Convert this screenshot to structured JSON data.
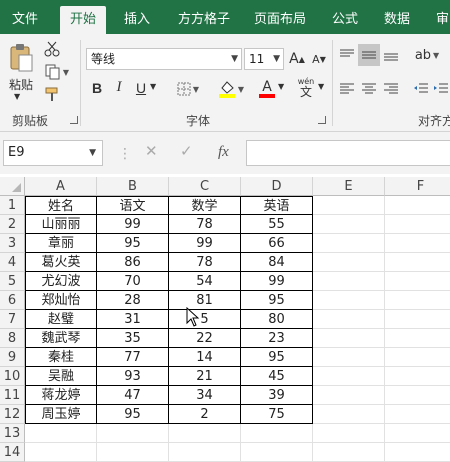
{
  "ribbon_tabs": [
    "文件",
    "开始",
    "插入",
    "方方格子",
    "页面布局",
    "公式",
    "数据",
    "审"
  ],
  "active_tab": "开始",
  "clipboard": {
    "paste_label": "粘贴",
    "group_label": "剪贴板"
  },
  "font": {
    "name": "等线",
    "size": "11",
    "group_label": "字体",
    "grow_label": "A",
    "shrink_label": "A",
    "bold_label": "B",
    "italic_label": "I",
    "underline_label": "U",
    "font_color_label": "A",
    "wen_label": "wén",
    "wen_char": "文"
  },
  "alignment": {
    "group_label": "对齐方"
  },
  "colors": {
    "ribbon_green": "#217346",
    "highlight_yellow": "#ffff00",
    "font_red": "#ff0000"
  },
  "formula_bar": {
    "name_box": "E9",
    "fx_label": "fx",
    "cancel_icon": "✕",
    "enter_icon": "✓",
    "value": ""
  },
  "columns": [
    "A",
    "B",
    "C",
    "D",
    "E",
    "F"
  ],
  "rows": [
    "1",
    "2",
    "3",
    "4",
    "5",
    "6",
    "7",
    "8",
    "9",
    "10",
    "11",
    "12",
    "13",
    "14"
  ],
  "table": {
    "headers": [
      "姓名",
      "语文",
      "数学",
      "英语"
    ],
    "rows": [
      [
        "山丽丽",
        "99",
        "78",
        "55"
      ],
      [
        "章丽",
        "95",
        "99",
        "66"
      ],
      [
        "葛火英",
        "86",
        "78",
        "84"
      ],
      [
        "尤幻波",
        "70",
        "54",
        "99"
      ],
      [
        "郑灿怡",
        "28",
        "81",
        "95"
      ],
      [
        "赵璧",
        "31",
        "5",
        "80"
      ],
      [
        "魏武琴",
        "35",
        "22",
        "23"
      ],
      [
        "秦桂",
        "77",
        "14",
        "95"
      ],
      [
        "吴融",
        "93",
        "21",
        "45"
      ],
      [
        "蒋龙婷",
        "47",
        "34",
        "39"
      ],
      [
        "周玉婷",
        "95",
        "2",
        "75"
      ]
    ]
  }
}
